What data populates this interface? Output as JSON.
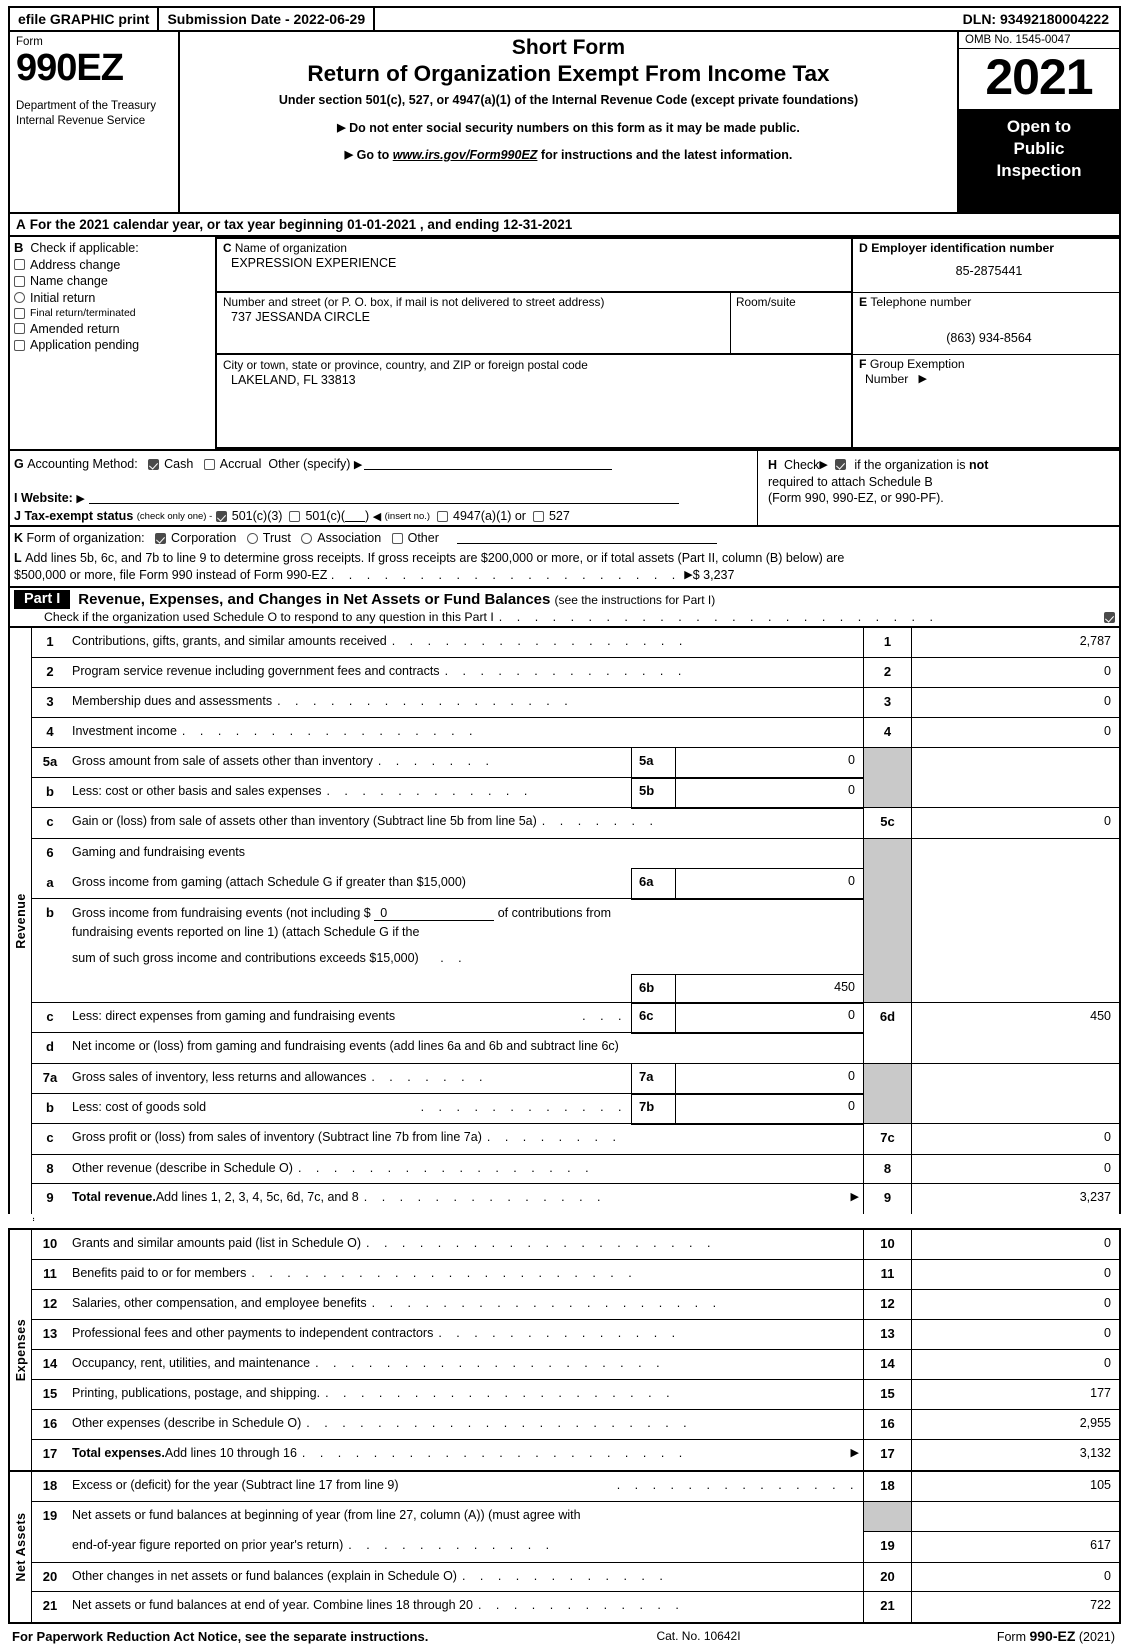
{
  "efile": {
    "graphic_print": "efile GRAPHIC print",
    "submission_date": "Submission Date - 2022-06-29",
    "dln": "DLN: 93492180004222"
  },
  "masthead": {
    "form_label": "Form",
    "form_number": "990EZ",
    "department": "Department of the Treasury\nInternal Revenue Service",
    "title_line1": "Short Form",
    "title_line2": "Return of Organization Exempt From Income Tax",
    "subtitle": "Under section 501(c), 527, or 4947(a)(1) of the Internal Revenue Code (except private foundations)",
    "bullet1": "Do not enter social security numbers on this form as it may be made public.",
    "bullet2_pre": "Go to ",
    "bullet2_link": "www.irs.gov/Form990EZ",
    "bullet2_post": " for instructions and the latest information.",
    "omb": "OMB No. 1545-0047",
    "year": "2021",
    "open_to_public": "Open to\nPublic\nInspection"
  },
  "line_a": {
    "letter": "A",
    "text": "For the 2021 calendar year, or tax year beginning 01-01-2021 , and ending 12-31-2021"
  },
  "section_b": {
    "letter": "B",
    "heading": "Check if applicable:",
    "items": [
      {
        "label": "Address change",
        "checked": false
      },
      {
        "label": "Name change",
        "checked": false
      },
      {
        "label": "Initial return",
        "checked": false
      },
      {
        "label": "Final return/terminated",
        "checked": false
      },
      {
        "label": "Amended return",
        "checked": false
      },
      {
        "label": "Application pending",
        "checked": false
      }
    ]
  },
  "section_c": {
    "letter": "C",
    "name_caption": "Name of organization",
    "name_value": "EXPRESSION EXPERIENCE",
    "street_caption": "Number and street (or P. O. box, if mail is not delivered to street address)",
    "street_value": "737 JESSANDA CIRCLE",
    "room_caption": "Room/suite",
    "room_value": "",
    "city_caption": "City or town, state or province, country, and ZIP or foreign postal code",
    "city_value": "LAKELAND, FL  33813"
  },
  "section_d": {
    "letter": "D",
    "caption": "Employer identification number",
    "value": "85-2875441"
  },
  "section_e": {
    "letter": "E",
    "caption": "Telephone number",
    "value": "(863) 934-8564"
  },
  "section_f": {
    "letter": "F",
    "caption_line1": "Group Exemption",
    "caption_line2": "Number"
  },
  "section_g": {
    "letter": "G",
    "label": "Accounting Method:",
    "cash_label": "Cash",
    "cash_checked": true,
    "accrual_label": "Accrual",
    "accrual_checked": false,
    "other_label": "Other (specify)",
    "other_value": ""
  },
  "section_h": {
    "letter": "H",
    "check_label": "Check",
    "checked": true,
    "text_line1_a": "if the organization is ",
    "text_line1_b": "not",
    "text_line2": "required to attach Schedule B",
    "text_line3": "(Form 990, 990-EZ, or 990-PF)."
  },
  "section_i": {
    "letter": "I",
    "label": "Website:",
    "value": ""
  },
  "section_j": {
    "letter": "J",
    "label": "Tax-exempt status",
    "note": "(check only one) -",
    "opt1_label": "501(c)(3)",
    "opt1_checked": true,
    "opt2_label": "501(c)(",
    "opt2_close": ")",
    "opt2_checked": false,
    "insert_no": "(insert no.)",
    "opt3_label": "4947(a)(1)",
    "opt3_checked": false,
    "or_label": "or",
    "opt4_label": "527",
    "opt4_checked": false
  },
  "section_k": {
    "letter": "K",
    "label": "Form of organization:",
    "options": [
      {
        "label": "Corporation",
        "checked": true
      },
      {
        "label": "Trust",
        "checked": false
      },
      {
        "label": "Association",
        "checked": false
      },
      {
        "label": "Other",
        "checked": false
      }
    ]
  },
  "section_l": {
    "letter": "L",
    "text_line1": "Add lines 5b, 6c, and 7b to line 9 to determine gross receipts. If gross receipts are $200,000 or more, or if total assets (Part II, column (B) below) are",
    "text_line2": "$500,000 or more, file Form 990 instead of Form 990-EZ",
    "leaders": ". . . . . . . . . . . . . . . . . . . .",
    "amount": "$ 3,237"
  },
  "part1": {
    "tag": "Part I",
    "title": "Revenue, Expenses, and Changes in Net Assets or Fund Balances",
    "title_note": "(see the instructions for Part I)",
    "schedule_o_text": "Check if the organization used Schedule O to respond to any question in this Part I",
    "schedule_o_checked": true
  },
  "side_labels": {
    "revenue": "Revenue",
    "expenses": "Expenses",
    "net_assets": "Net Assets"
  },
  "revenue_rows": [
    {
      "n": "1",
      "desc": "Contributions, gifts, grants, and similar amounts received",
      "num": "1",
      "amount": "2,787"
    },
    {
      "n": "2",
      "desc": "Program service revenue including government fees and contracts",
      "num": "2",
      "amount": "0"
    },
    {
      "n": "3",
      "desc": "Membership dues and assessments",
      "num": "3",
      "amount": "0"
    },
    {
      "n": "4",
      "desc": "Investment income",
      "num": "4",
      "amount": "0"
    },
    {
      "n": "5a",
      "desc": "Gross amount from sale of assets other than inventory",
      "sub_label": "5a",
      "sub_value": "0"
    },
    {
      "n": "b",
      "desc": "Less: cost or other basis and sales expenses",
      "sub_label": "5b",
      "sub_value": "0"
    },
    {
      "n": "c",
      "desc": "Gain or (loss) from sale of assets other than inventory (Subtract line 5b from line 5a)",
      "num": "5c",
      "amount": "0"
    },
    {
      "n": "6",
      "desc": "Gaming and fundraising events"
    },
    {
      "n": "a",
      "desc": "Gross income from gaming (attach Schedule G if greater than $15,000)",
      "sub_label": "6a",
      "sub_value": "0"
    },
    {
      "n": "b",
      "desc_l1_pre": "Gross income from fundraising events (not including $",
      "inline_value": "0",
      "desc_l1_post": "of contributions from",
      "desc_l2": "fundraising events reported on line 1) (attach Schedule G if the",
      "desc_l3": "sum of such gross income and contributions exceeds $15,000)",
      "sub_label": "6b",
      "sub_value": "450"
    },
    {
      "n": "c",
      "desc": "Less: direct expenses from gaming and fundraising events",
      "sub_label": "6c",
      "sub_value": "0"
    },
    {
      "n": "d",
      "desc": "Net income or (loss) from gaming and fundraising events (add lines 6a and 6b and subtract line 6c)",
      "num": "6d",
      "amount": "450"
    },
    {
      "n": "7a",
      "desc": "Gross sales of inventory, less returns and allowances",
      "sub_label": "7a",
      "sub_value": "0"
    },
    {
      "n": "b",
      "desc": "Less: cost of goods sold",
      "sub_label": "7b",
      "sub_value": "0"
    },
    {
      "n": "c",
      "desc": "Gross profit or (loss) from sales of inventory (Subtract line 7b from line 7a)",
      "num": "7c",
      "amount": "0"
    },
    {
      "n": "8",
      "desc": "Other revenue (describe in Schedule O)",
      "num": "8",
      "amount": "0"
    },
    {
      "n": "9",
      "desc_bold": "Total revenue.",
      "desc": " Add lines 1, 2, 3, 4, 5c, 6d, 7c, and 8",
      "num": "9",
      "amount": "3,237",
      "arrow": true
    }
  ],
  "expense_rows": [
    {
      "n": "10",
      "desc": "Grants and similar amounts paid (list in Schedule O)",
      "num": "10",
      "amount": "0"
    },
    {
      "n": "11",
      "desc": "Benefits paid to or for members",
      "num": "11",
      "amount": "0"
    },
    {
      "n": "12",
      "desc": "Salaries, other compensation, and employee benefits",
      "num": "12",
      "amount": "0"
    },
    {
      "n": "13",
      "desc": "Professional fees and other payments to independent contractors",
      "num": "13",
      "amount": "0"
    },
    {
      "n": "14",
      "desc": "Occupancy, rent, utilities, and maintenance",
      "num": "14",
      "amount": "0"
    },
    {
      "n": "15",
      "desc": "Printing, publications, postage, and shipping.",
      "num": "15",
      "amount": "177"
    },
    {
      "n": "16",
      "desc": "Other expenses (describe in Schedule O)",
      "num": "16",
      "amount": "2,955"
    },
    {
      "n": "17",
      "desc_bold": "Total expenses.",
      "desc": " Add lines 10 through 16",
      "num": "17",
      "amount": "3,132",
      "arrow": true
    }
  ],
  "netasset_rows": [
    {
      "n": "18",
      "desc": "Excess or (deficit) for the year (Subtract line 17 from line 9)",
      "num": "18",
      "amount": "105"
    },
    {
      "n": "19",
      "desc_l1": "Net assets or fund balances at beginning of year (from line 27, column (A)) (must agree with",
      "desc_l2": "end-of-year figure reported on prior year's return)",
      "num": "19",
      "amount": "617"
    },
    {
      "n": "20",
      "desc": "Other changes in net assets or fund balances (explain in Schedule O)",
      "num": "20",
      "amount": "0"
    },
    {
      "n": "21",
      "desc": "Net assets or fund balances at end of year. Combine lines 18 through 20",
      "num": "21",
      "amount": "722"
    }
  ],
  "footer": {
    "notice": "For Paperwork Reduction Act Notice, see the separate instructions.",
    "cat": "Cat. No. 10642I",
    "form_pre": "Form ",
    "form_bold": "990-EZ",
    "form_year": " (2021)"
  },
  "leaders": {
    "d1": ". . . . . . . . . . . . . . . . .",
    "d2": ". . . . . . . . . . . . . .",
    "d3": ". . . . . . . . . . . . . . . . . . . .",
    "d4": ". . . . . . . . . . . . . . . . . . . . . .",
    "d5": ". . . . . . .",
    "d6": ". . . . . . . . . . . .",
    "d7": ". . . . . . . .",
    "d8": ". .",
    "d9": ". . .",
    "schedO": ". . . . . . . . . . . . . . . . . . . . . . . . ."
  }
}
